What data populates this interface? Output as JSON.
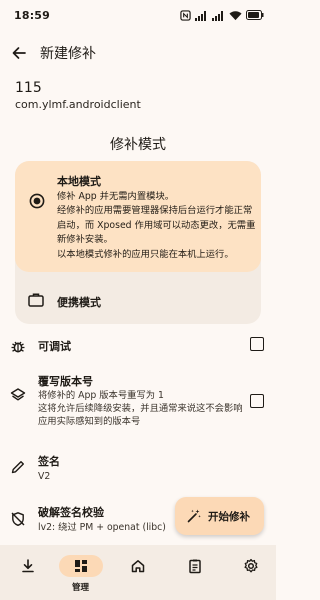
{
  "status_bar": {
    "time": "18:59"
  },
  "app_bar": {
    "title": "新建修补"
  },
  "app": {
    "name": "115",
    "package": "com.ylmf.androidclient"
  },
  "section_title": "修补模式",
  "modes": {
    "local": {
      "title": "本地模式",
      "description": "修补 App 并无需内置模块。\n经修补的应用需要管理器保持后台运行才能正常启动，而 Xposed 作用域可以动态更改，无需重新修补安装。\n以本地模式修补的应用只能在本机上运行。",
      "selected": true
    },
    "portable": {
      "title": "便携模式",
      "selected": false
    }
  },
  "options": {
    "debuggable": {
      "title": "可调试",
      "checked": false
    },
    "override_version": {
      "title": "覆写版本号",
      "description": "将修补的 App 版本号重写为 1\n这将允许后续降级安装，并且通常来说这不会影响应用实际感知到的版本号",
      "checked": false
    },
    "signature": {
      "title": "签名",
      "value": "V2"
    },
    "bypass_signature": {
      "title": "破解签名校验",
      "value": "lv2: 绕过 PM + openat (libc)"
    }
  },
  "fab": {
    "label": "开始修补"
  },
  "bottom_nav": {
    "items": [
      {
        "icon": "download-icon",
        "label": "",
        "active": false
      },
      {
        "icon": "dashboard-icon",
        "label": "管理",
        "active": true
      },
      {
        "icon": "home-icon",
        "label": "",
        "active": false
      },
      {
        "icon": "clipboard-icon",
        "label": "",
        "active": false
      },
      {
        "icon": "gear-icon",
        "label": "",
        "active": false
      }
    ]
  },
  "colors": {
    "background": "#fdf8f4",
    "accent": "#fde2c4",
    "fab": "#fcd9b6",
    "nav_background": "#f4ece4",
    "text": "#1f1b16"
  }
}
